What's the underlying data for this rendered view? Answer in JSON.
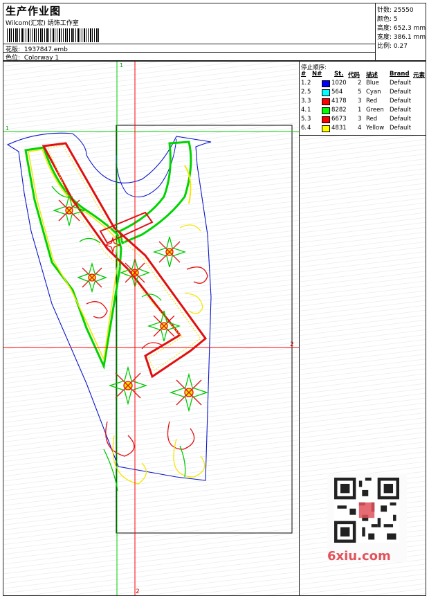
{
  "header": {
    "title": "生产作业图",
    "studio": "Wilcom(汇宏) 绣饰工作室",
    "design_label": "花版:",
    "design_value": "1937847.emb",
    "colorway_label": "色位:",
    "colorway_value": "Colorway 1"
  },
  "specs": [
    {
      "label": "针数:",
      "value": "25550"
    },
    {
      "label": "颜色:",
      "value": "5"
    },
    {
      "label": "高度:",
      "value": "652.3 mm"
    },
    {
      "label": "宽度:",
      "value": "386.1 mm"
    },
    {
      "label": "比例:",
      "value": "0.27"
    }
  ],
  "legend": {
    "title": "停止顺序:",
    "headers": [
      "#",
      "N#",
      "St.",
      "代码",
      "描述",
      "Brand",
      "元素"
    ],
    "rows": [
      {
        "order": "1.",
        "n": "2",
        "color": "#0000ff",
        "stitches": "1020",
        "code": "2",
        "desc": "Blue",
        "brand": "Default"
      },
      {
        "order": "2.",
        "n": "5",
        "color": "#00ffff",
        "stitches": "564",
        "code": "5",
        "desc": "Cyan",
        "brand": "Default"
      },
      {
        "order": "3.",
        "n": "3",
        "color": "#ff0000",
        "stitches": "4178",
        "code": "3",
        "desc": "Red",
        "brand": "Default"
      },
      {
        "order": "4.",
        "n": "1",
        "color": "#00ff00",
        "stitches": "8282",
        "code": "1",
        "desc": "Green",
        "brand": "Default"
      },
      {
        "order": "5.",
        "n": "3",
        "color": "#ff0000",
        "stitches": "6673",
        "code": "3",
        "desc": "Red",
        "brand": "Default"
      },
      {
        "order": "6.",
        "n": "4",
        "color": "#ffff00",
        "stitches": "4831",
        "code": "4",
        "desc": "Yellow",
        "brand": "Default"
      }
    ]
  },
  "guides": {
    "h1": "1",
    "h2": "2",
    "v1": "1",
    "v2": "2"
  },
  "watermark": "6xiu.com"
}
